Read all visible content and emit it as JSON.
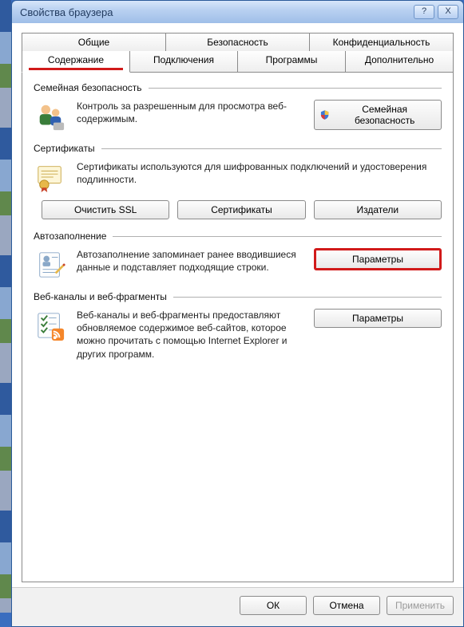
{
  "window": {
    "title": "Свойства браузера"
  },
  "titlebar": {
    "help": "?",
    "close": "X"
  },
  "tabs": {
    "row1": [
      "Общие",
      "Безопасность",
      "Конфиденциальность"
    ],
    "row2": [
      "Содержание",
      "Подключения",
      "Программы",
      "Дополнительно"
    ],
    "active": "Содержание"
  },
  "groups": {
    "family": {
      "title": "Семейная безопасность",
      "text": "Контроль за разрешенным для просмотра веб-содержимым.",
      "button": "Семейная безопасность"
    },
    "certs": {
      "title": "Сертификаты",
      "text": "Сертификаты используются для шифрованных подключений и удостоверения подлинности.",
      "btn_clear": "Очистить SSL",
      "btn_certs": "Сертификаты",
      "btn_pub": "Издатели"
    },
    "autofill": {
      "title": "Автозаполнение",
      "text": "Автозаполнение запоминает ранее вводившиеся данные и подставляет подходящие строки.",
      "button": "Параметры"
    },
    "feeds": {
      "title": "Веб-каналы и веб-фрагменты",
      "text": "Веб-каналы и веб-фрагменты предоставляют обновляемое содержимое веб-сайтов, которое можно прочитать с помощью Internet Explorer и других программ.",
      "button": "Параметры"
    }
  },
  "dialog": {
    "ok": "ОК",
    "cancel": "Отмена",
    "apply": "Применить"
  }
}
